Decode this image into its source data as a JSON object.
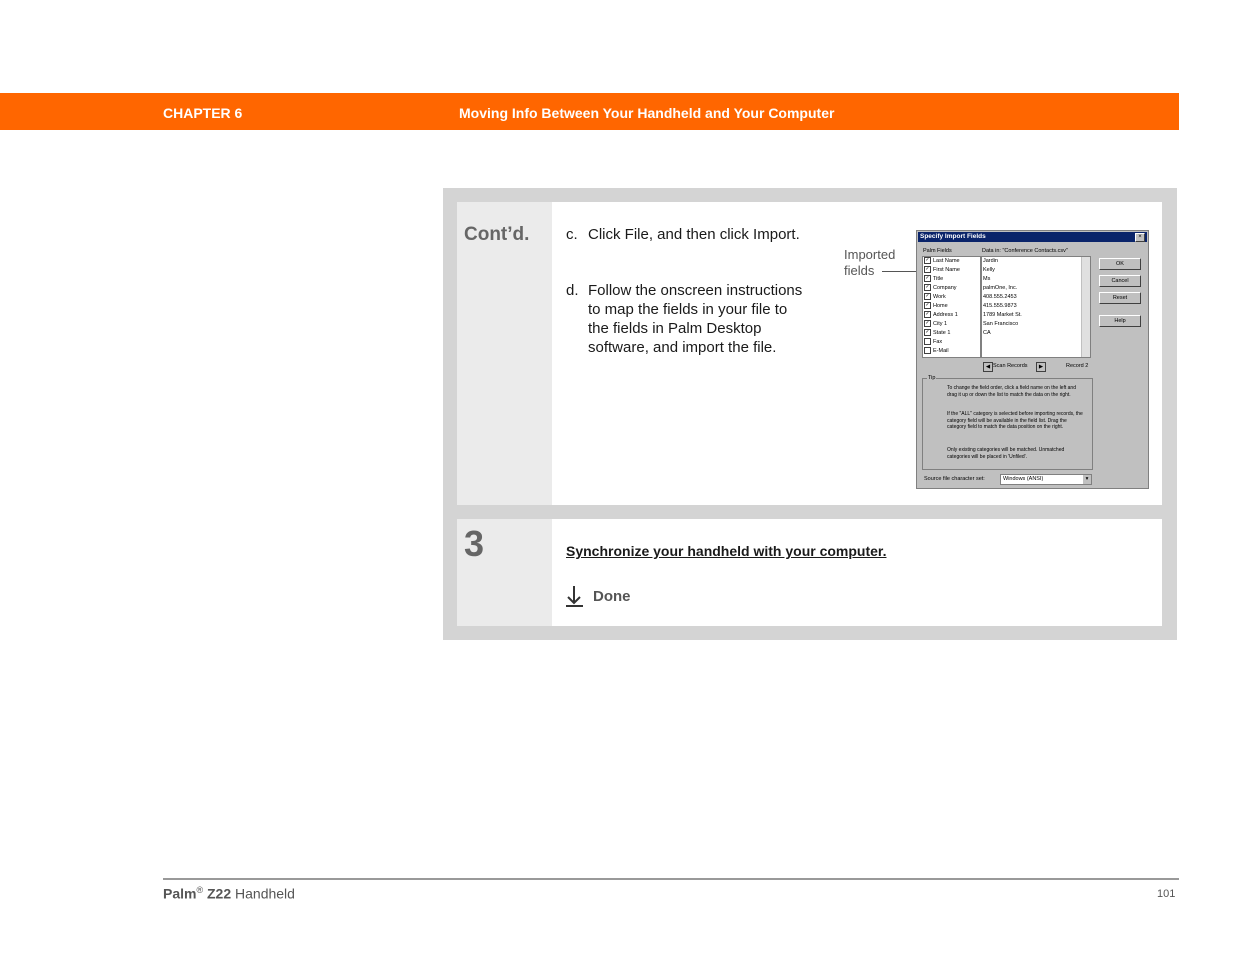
{
  "header": {
    "chapter": "CHAPTER 6",
    "title": "Moving Info Between Your Handheld and Your Computer",
    "band_color": "#ff6600"
  },
  "step_continued": {
    "label": "Cont’d.",
    "items": [
      {
        "letter": "c.",
        "text": "Click File, and then click Import."
      },
      {
        "letter": "d.",
        "text": "Follow the onscreen instructions to map the fields in your file to the fields in Palm Desktop software, and import the file."
      }
    ],
    "callout": "Imported fields"
  },
  "dialog": {
    "title": "Specify Import Fields",
    "close_glyph": "×",
    "palm_fields_label": "Palm Fields",
    "data_in_label": "Data in: \"Conference Contacts.csv\"",
    "palm_fields": [
      {
        "name": "Last Name",
        "checked": true
      },
      {
        "name": "First Name",
        "checked": true
      },
      {
        "name": "Title",
        "checked": true
      },
      {
        "name": "Company",
        "checked": true
      },
      {
        "name": "Work",
        "checked": true
      },
      {
        "name": "Home",
        "checked": true
      },
      {
        "name": "Address 1",
        "checked": true
      },
      {
        "name": "City 1",
        "checked": true
      },
      {
        "name": "State 1",
        "checked": true
      },
      {
        "name": "Fax",
        "checked": false
      },
      {
        "name": "E-Mail",
        "checked": false
      }
    ],
    "data_values": [
      "Jardin",
      "Kelly",
      "Ms",
      "palmOne, Inc.",
      "408.555.2453",
      "415.555.9873",
      "1789 Market St.",
      "San Francisco",
      "CA"
    ],
    "buttons": {
      "ok": "OK",
      "cancel": "Cancel",
      "reset": "Reset",
      "help": "Help"
    },
    "scan_records": "Scan Records",
    "record": "Record 2",
    "tip_label": "Tip",
    "tips": [
      "To change the field order, click a field name on the left and drag it up or down the list to match the data on the right.",
      "If the \"ALL\" category is selected before importing records, the category field will be available in the field list. Drag the category field to match the data position on the right.",
      "Only existing categories will be matched. Unmatched categories will be placed in 'Unfiled'."
    ],
    "charset_label": "Source file character set:",
    "charset_value": "Windows (ANSI)"
  },
  "step3": {
    "number": "3",
    "link": "Synchronize your handheld with your computer.",
    "done": "Done"
  },
  "footer": {
    "brand": "Palm",
    "reg": "®",
    "model": "Z22",
    "product": "Handheld",
    "page": "101"
  }
}
